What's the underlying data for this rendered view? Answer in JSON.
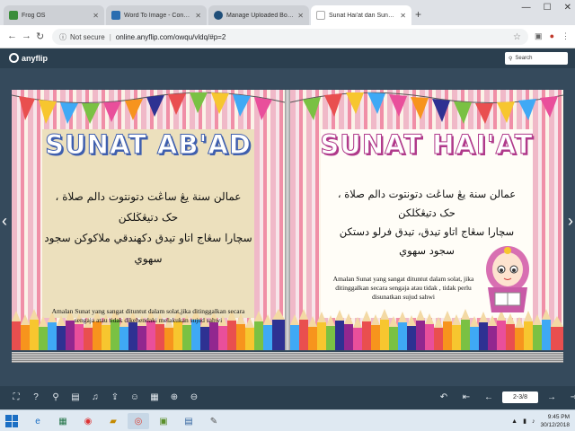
{
  "browser": {
    "tabs": [
      {
        "title": "Frog OS",
        "favicon_color": "#3a8d3a",
        "active": false
      },
      {
        "title": "Word To Image - Convert your D",
        "favicon_color": "#2a6db0",
        "active": false
      },
      {
        "title": "Manage Uploaded Books | AnyFl",
        "favicon_color": "#1f4e79",
        "active": false
      },
      {
        "title": "Sunat Hai'at dan Sunat Ab'a",
        "favicon_color": "#cccccc",
        "active": true
      }
    ],
    "new_tab": "+",
    "window_controls": [
      "—",
      "☐",
      "✕"
    ],
    "security_label": "Not secure",
    "url": "online.anyflip.com/owqu/vldq/#p=2"
  },
  "anyflip": {
    "logo_text": "anyflip",
    "search_placeholder": "Search"
  },
  "book": {
    "left_page": {
      "title": "SUNAT AB'AD",
      "jawi_lines": [
        "عمالن سنة يڠ ساڠت دتونتوت دالم صلاة ،",
        "حک دتيڠڬلکن",
        "سچارا سڠاج اتاو تيدق دکهندقي ملاکوکن سجود",
        "سهوي"
      ],
      "malay_text": "Amalan Sunat yang sangat dituntut dalam solat,jika ditinggalkan secara sengaja atau tidak dikehendaki melakukan sujud sahwi"
    },
    "right_page": {
      "title": "SUNAT HAI'AT",
      "jawi_lines": [
        "عمالن سنة يڠ ساڠت دتونتوت دالم صلاة ،",
        "حک دتيڠڬلکن",
        "سچارا سڠاج اتاو تيدق، تيدق فرلو دستکن",
        "سجود سهوي"
      ],
      "malay_text": "Amalan Sunat yang sangat dituntut dalam solat, jika ditinggalkan secara sengaja atau tidak , tidak perlu disunatkan sujud sahwi"
    }
  },
  "toolbar": {
    "left_icons": [
      "fullscreen-icon",
      "help-icon",
      "search-icon",
      "print-icon",
      "sound-icon",
      "share-icon",
      "social-icon",
      "thumbnails-icon",
      "zoom-in-icon",
      "zoom-out-icon"
    ],
    "page_indicator": "2-3/8"
  },
  "taskbar": {
    "time": "9:45 PM",
    "date": "30/12/2018"
  }
}
